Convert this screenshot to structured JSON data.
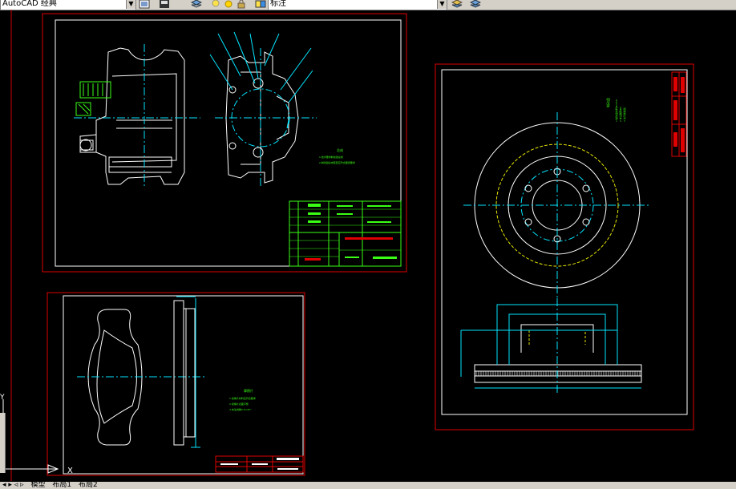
{
  "toolbar": {
    "workspace_value": "AutoCAD 经典",
    "dimstyle_value": "标注",
    "colors": {
      "bar": "#d4d0c8"
    }
  },
  "sheet1": {
    "title_text": "总成",
    "note_lines": [
      "1.技术要求制动钳总成",
      "2.制动钳总成装配应符合图纸要求"
    ]
  },
  "sheet2": {
    "title_text": "摩擦片",
    "note_lines": [
      "1.摩擦片材料应符合要求",
      "2.摩擦片表面平整",
      "3.未注倒角0.5×45°"
    ]
  },
  "sheet3": {
    "title_text": "制动盘",
    "note_lines": [
      "1.制动盘材料HT250",
      "2.未注圆角R2",
      "3.动平衡检验"
    ]
  },
  "ucs": {
    "x_label": "X",
    "y_label": "Y"
  },
  "tabs": [
    "模型",
    "布局1",
    "布局2"
  ]
}
